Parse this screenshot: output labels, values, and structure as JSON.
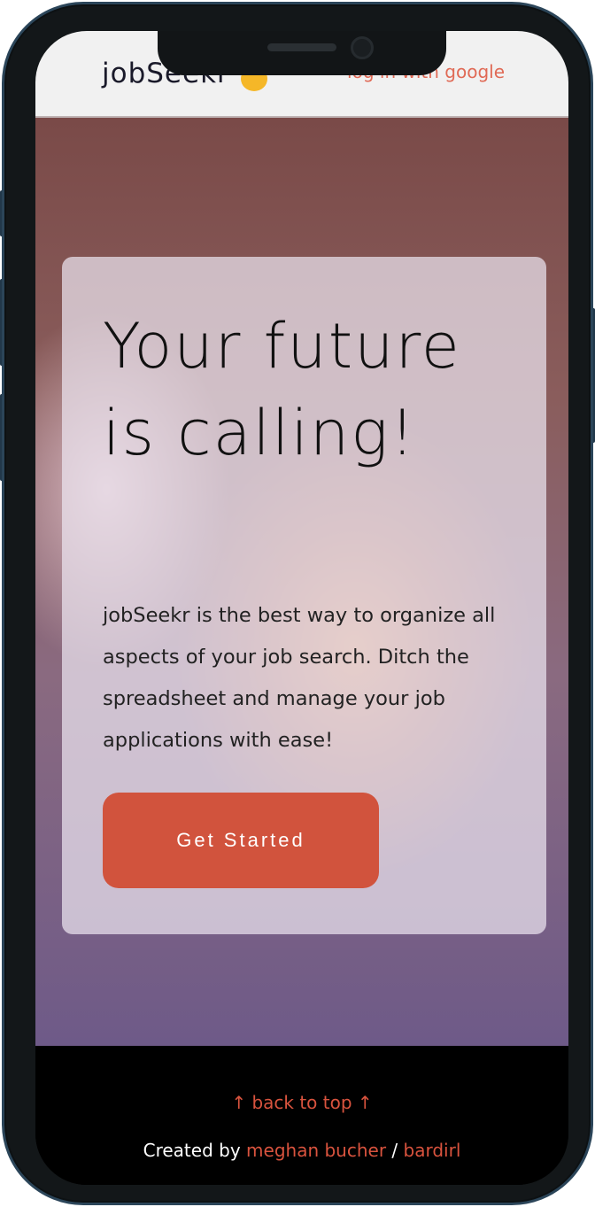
{
  "header": {
    "logo": "jobSeekr",
    "logo_icon": "handshake-icon",
    "login": "log in with google"
  },
  "hero": {
    "title": "Your future is calling!",
    "description": "jobSeekr is the best way to organize all aspects of your job search. Ditch the spreadsheet and manage your job applications with ease!",
    "cta": "Get Started"
  },
  "footer": {
    "back_to_top": "↑ back to top ↑",
    "created_by": "Created by",
    "author": "meghan bucher",
    "separator": " / ",
    "handle": "bardirl"
  },
  "colors": {
    "accent": "#d1533d",
    "header_bg": "#f1f1f1",
    "footer_bg": "#000000"
  }
}
